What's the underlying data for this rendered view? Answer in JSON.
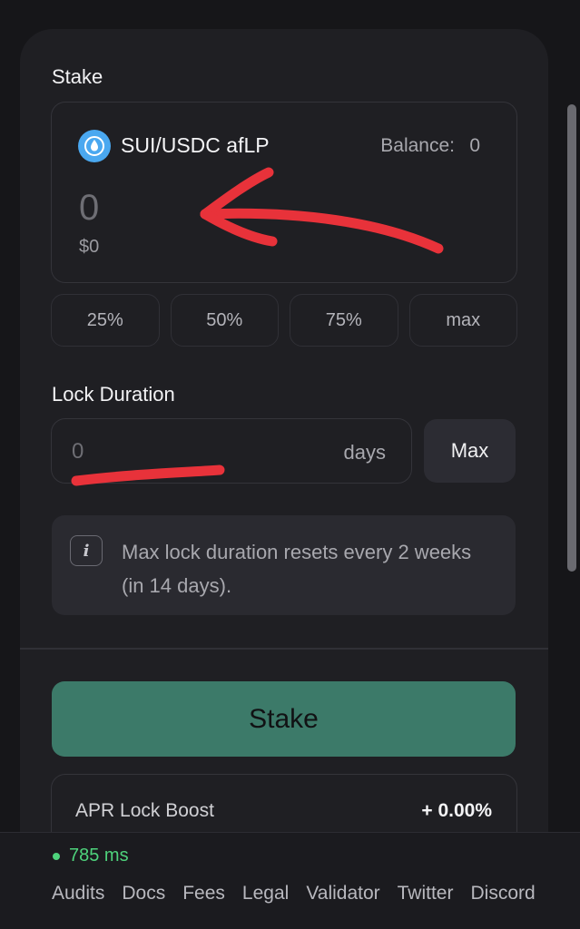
{
  "stake": {
    "title": "Stake",
    "token_name": "SUI/USDC afLP",
    "token_icon": "droplet-icon",
    "balance_label": "Balance:",
    "balance_value": "0",
    "amount": "0",
    "usd_value": "$0",
    "percent_buttons": [
      "25%",
      "50%",
      "75%",
      "max"
    ]
  },
  "lock": {
    "title": "Lock Duration",
    "days_value": "0",
    "days_unit": "days",
    "max_label": "Max",
    "info_text": "Max lock duration resets every 2 weeks (in 14 days).",
    "info_icon": "info-icon"
  },
  "actions": {
    "stake_label": "Stake"
  },
  "apr": {
    "label": "APR Lock Boost",
    "value": "+ 0.00%"
  },
  "footer": {
    "latency": "785 ms",
    "links": [
      "Audits",
      "Docs",
      "Fees",
      "Legal",
      "Validator",
      "Twitter",
      "Discord"
    ]
  },
  "colors": {
    "accent": "#3c7a69",
    "status_ok": "#4ed37c",
    "annotation": "#e8323a",
    "token_icon": "#4aa8f0"
  }
}
